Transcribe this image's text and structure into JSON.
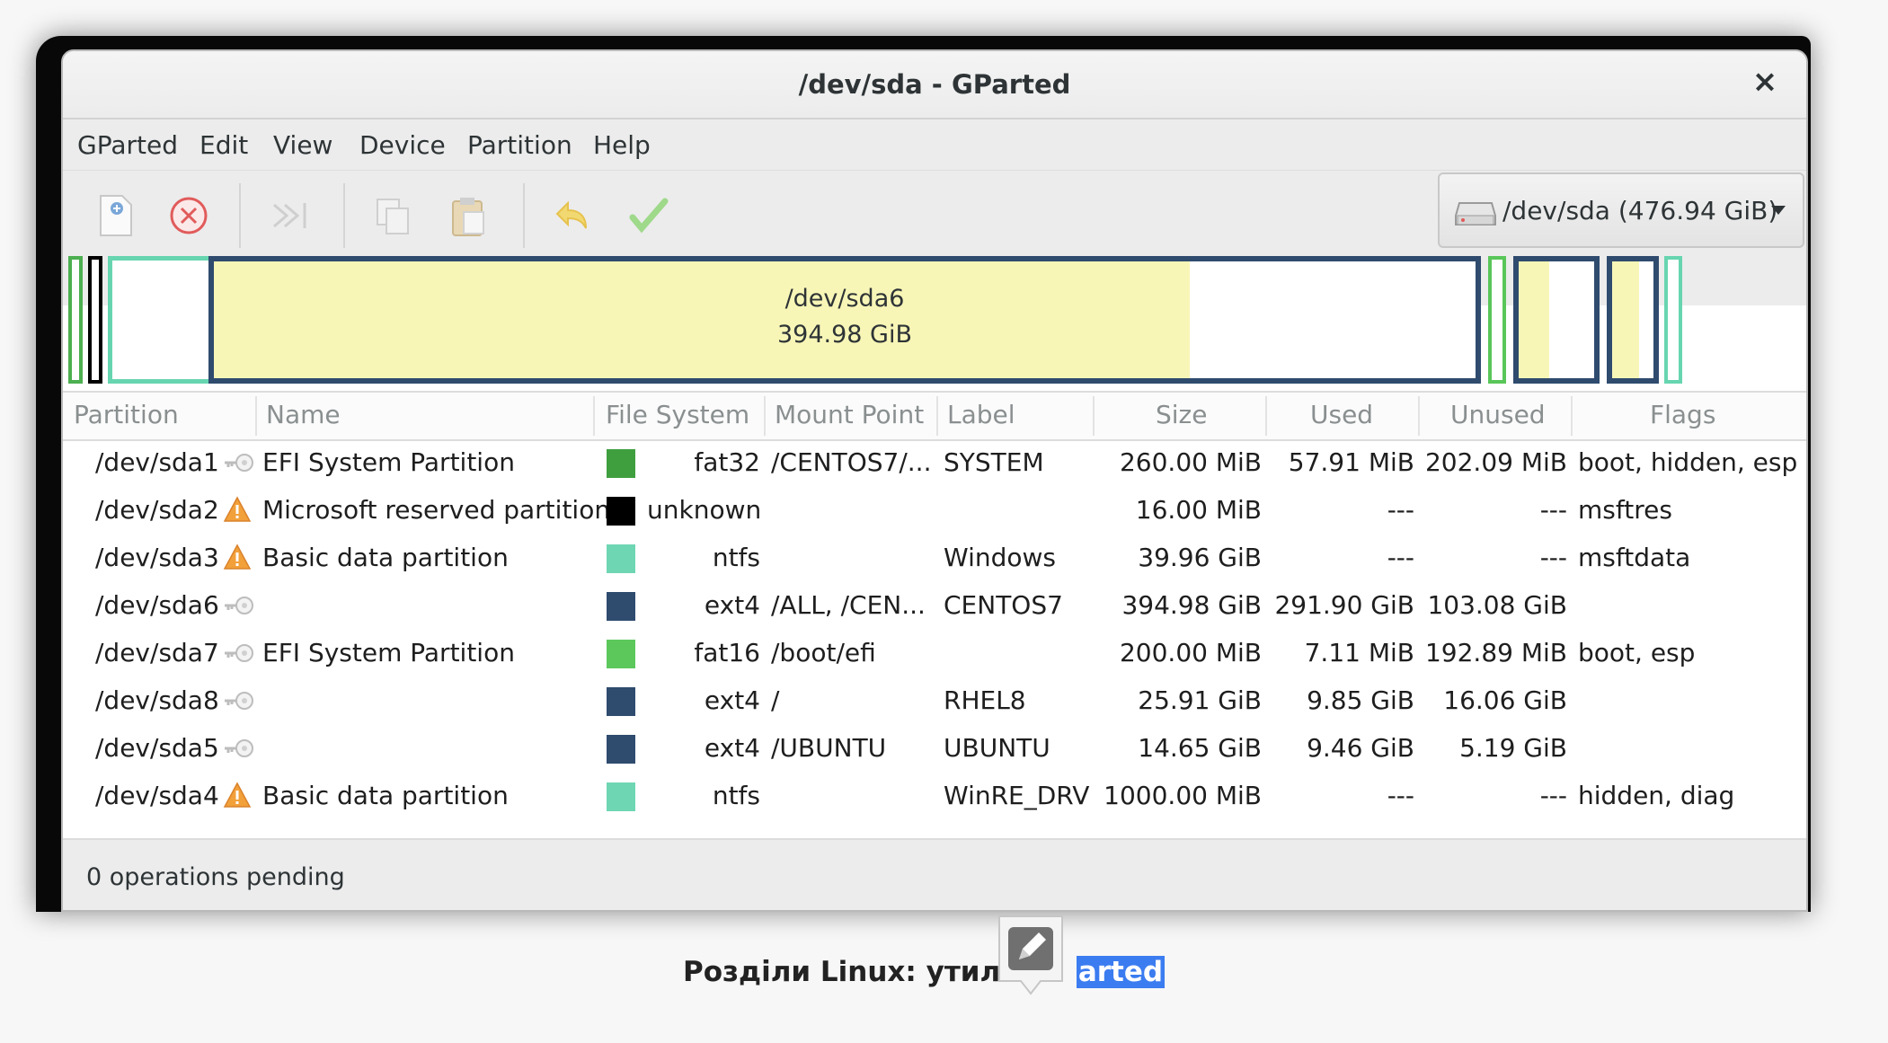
{
  "window": {
    "title": "/dev/sda - GParted",
    "close_label": "×"
  },
  "menubar": {
    "items": [
      "GParted",
      "Edit",
      "View",
      "Device",
      "Partition",
      "Help"
    ]
  },
  "toolbar": {
    "buttons": [
      "new-icon",
      "delete-icon",
      "resize-move-icon",
      "copy-icon",
      "paste-icon",
      "undo-icon",
      "apply-icon"
    ],
    "device_label": "/dev/sda  (476.94 GiB)"
  },
  "graph": {
    "selected_name": "/dev/sda6",
    "selected_size": "394.98 GiB",
    "colors": {
      "fat32": "#4caf50",
      "ntfs": "#67d5b0",
      "ext4": "#2f4b6e",
      "fat16": "#59c659",
      "unknown": "#000000",
      "used": "#f8f6b7"
    }
  },
  "table": {
    "headers": [
      "Partition",
      "Name",
      "File System",
      "Mount Point",
      "Label",
      "Size",
      "Used",
      "Unused",
      "Flags"
    ],
    "rows": [
      {
        "partition": "/dev/sda1",
        "icon": "key-icon",
        "name": "EFI System Partition",
        "color": "#3f9f3f",
        "fs": "fat32",
        "mount": "/CENTOS7/...",
        "label": "SYSTEM",
        "size": "260.00 MiB",
        "used": "57.91 MiB",
        "unused": "202.09 MiB",
        "flags": "boot, hidden, esp"
      },
      {
        "partition": "/dev/sda2",
        "icon": "warning-icon",
        "name": "Microsoft reserved partition",
        "color": "#000000",
        "fs": "unknown",
        "mount": "",
        "label": "",
        "size": "16.00 MiB",
        "used": "---",
        "unused": "---",
        "flags": "msftres"
      },
      {
        "partition": "/dev/sda3",
        "icon": "warning-icon",
        "name": "Basic data partition",
        "color": "#6fd6b4",
        "fs": "ntfs",
        "mount": "",
        "label": "Windows",
        "size": "39.96 GiB",
        "used": "---",
        "unused": "---",
        "flags": "msftdata"
      },
      {
        "partition": "/dev/sda6",
        "icon": "key-icon",
        "name": "",
        "color": "#2f4b6e",
        "fs": "ext4",
        "mount": "/ALL, /CEN...",
        "label": "CENTOS7",
        "size": "394.98 GiB",
        "used": "291.90 GiB",
        "unused": "103.08 GiB",
        "flags": ""
      },
      {
        "partition": "/dev/sda7",
        "icon": "key-icon",
        "name": "EFI System Partition",
        "color": "#5cc85c",
        "fs": "fat16",
        "mount": "/boot/efi",
        "label": "",
        "size": "200.00 MiB",
        "used": "7.11 MiB",
        "unused": "192.89 MiB",
        "flags": "boot, esp"
      },
      {
        "partition": "/dev/sda8",
        "icon": "key-icon",
        "name": "",
        "color": "#2f4b6e",
        "fs": "ext4",
        "mount": "/",
        "label": "RHEL8",
        "size": "25.91 GiB",
        "used": "9.85 GiB",
        "unused": "16.06 GiB",
        "flags": ""
      },
      {
        "partition": "/dev/sda5",
        "icon": "key-icon",
        "name": "",
        "color": "#2f4b6e",
        "fs": "ext4",
        "mount": "/UBUNTU",
        "label": "UBUNTU",
        "size": "14.65 GiB",
        "used": "9.46 GiB",
        "unused": "5.19 GiB",
        "flags": ""
      },
      {
        "partition": "/dev/sda4",
        "icon": "warning-icon",
        "name": "Basic data partition",
        "color": "#6fd6b4",
        "fs": "ntfs",
        "mount": "",
        "label": "WinRE_DRV",
        "size": "1000.00 MiB",
        "used": "---",
        "unused": "---",
        "flags": "hidden, diag"
      }
    ]
  },
  "statusbar": {
    "text": "0 operations pending"
  },
  "caption": {
    "text": "Розділи Linux: утиліт",
    "selected_text": "arted"
  }
}
